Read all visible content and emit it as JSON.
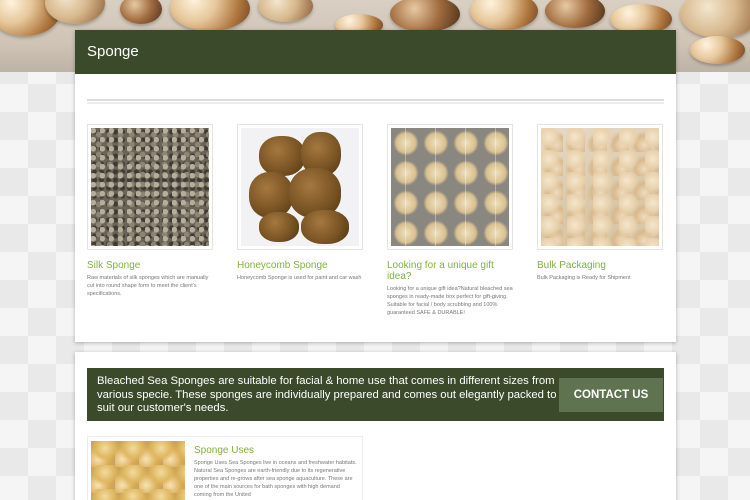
{
  "page_title": "Sponge",
  "products": [
    {
      "title": "Silk Sponge",
      "description": "Raw materials of silk sponges which are manually cut into round shape form to meet the client's specifications."
    },
    {
      "title": "Honeycomb Sponge",
      "description": "Honeycomb Sponge is used for paint and car wash"
    },
    {
      "title": "Looking for a unique gift idea?",
      "description": "Looking for a unique gift idea?Natural bleached sea sponges in ready-made box perfect for gift-giving. Suitable for facial / body scrubbing and 100% guaranteed SAFE & DURABLE!"
    },
    {
      "title": "Bulk Packaging",
      "description": "Bulk Packaging is Ready for Shipment"
    }
  ],
  "cta": {
    "text": "Bleached Sea Sponges are suitable for facial & home use that comes in different sizes from various specie. These sponges are individually prepared and comes out elegantly packed to suit our customer's needs.",
    "button_label": "CONTACT US"
  },
  "feature": {
    "title": "Sponge Uses",
    "description": "Sponge Uses Sea Sponges live in oceans and freshwater habitats. Natural Sea Sponges are earth-friendly due to its regenerative properties and re-grows after sea sponge aquaculture. These are one of the main sources for bath sponges with high demand coming from the United"
  },
  "colors": {
    "header_bg": "#3a4a2b",
    "accent_green": "#7fb23e",
    "button_bg": "#5f7350"
  }
}
